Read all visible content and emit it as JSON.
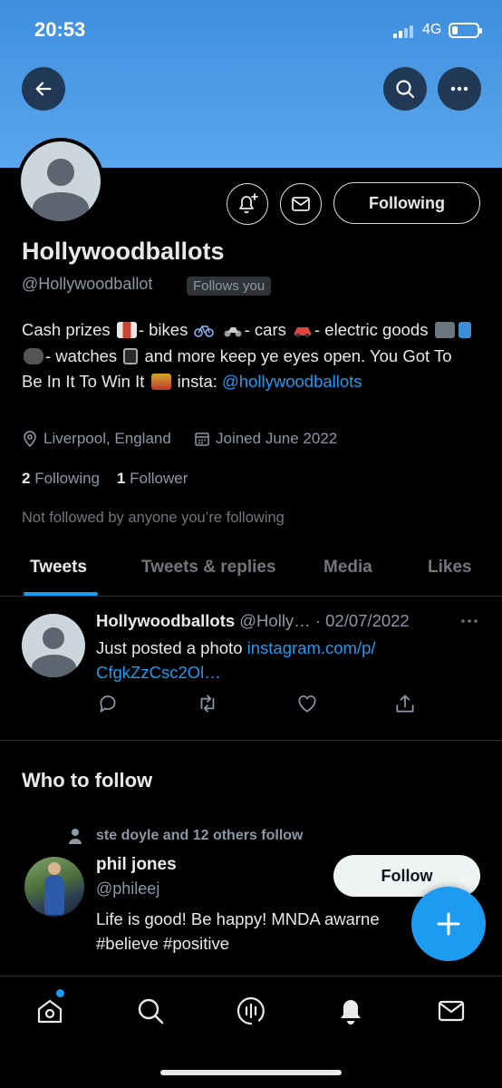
{
  "status": {
    "time": "20:53",
    "network": "4G"
  },
  "profile": {
    "display_name": "Hollywoodballots",
    "handle": "@Hollywoodballot",
    "follows_you": "Follows you",
    "following_label": "Following",
    "bio": {
      "p1": "Cash prizes",
      "p2": "- bikes",
      "p3": "- cars",
      "p4": "- electric goods",
      "p5": "- watches",
      "p6": "and more keep ye eyes open. You Got To Be In It To Win It",
      "p7": "insta:",
      "link": "@hollywoodballots"
    },
    "location": "Liverpool, England",
    "joined": "Joined June 2022",
    "following_count": "2",
    "following_text": "Following",
    "followers_count": "1",
    "followers_text": "Follower",
    "not_followed": "Not followed by anyone you’re following"
  },
  "tabs": [
    {
      "label": "Tweets",
      "active": true
    },
    {
      "label": "Tweets & replies"
    },
    {
      "label": "Media"
    },
    {
      "label": "Likes"
    }
  ],
  "tweet": {
    "name": "Hollywoodballots",
    "handle": "@Holly…",
    "date": "· 02/07/2022",
    "text": "Just posted a photo",
    "link": "instagram.com/p/ CfgkZzCsc2Ol…"
  },
  "who_to_follow": {
    "title": "Who to follow",
    "social_context": "ste doyle and 12 others follow",
    "name": "phil jones",
    "handle": "@phileej",
    "bio_line1": "Life is good! Be happy! MNDA awarne",
    "bio_line2": "#believe #positive",
    "follow_label": "Follow"
  },
  "colors": {
    "accent": "#1d9bf0",
    "banner": "#4a9ae6",
    "background": "#000000"
  },
  "icons": [
    "back-arrow-icon",
    "search-icon",
    "more-icon",
    "bell-plus-icon",
    "mail-icon",
    "location-pin-icon",
    "calendar-icon",
    "reply-icon",
    "retweet-icon",
    "like-icon",
    "share-icon",
    "person-icon",
    "plus-icon",
    "home-icon",
    "spaces-icon",
    "bell-icon"
  ]
}
